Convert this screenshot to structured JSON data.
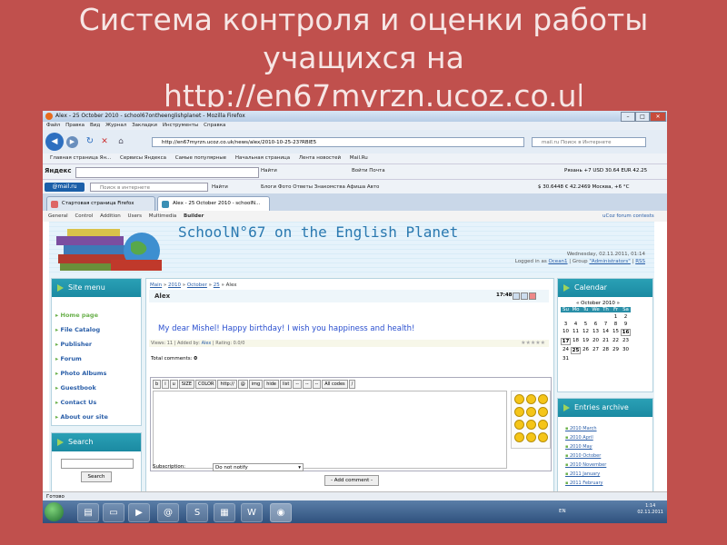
{
  "slide": {
    "title_line1": "Система контроля и оценки работы",
    "title_line2": "учащихся на",
    "url": "http://en67myrzn.ucoz.co.uk"
  },
  "browser": {
    "window_title": "Alex - 25 October 2010 - school67ontheenglishplanet - Mozilla Firefox",
    "menu": [
      "Файл",
      "Правка",
      "Вид",
      "Журнал",
      "Закладки",
      "Инструменты",
      "Справка"
    ],
    "address": "http://en67myrzn.ucoz.co.uk/news/alex/2010-10-25-23?RBlE5",
    "search_placeholder": "mail.ru Поиск в Интернете",
    "bookmarks": [
      "Главная страница Ян...",
      "Сервисы Яндекса",
      "Самые популярные",
      "Начальная страница",
      "Лента новостей",
      "Mail.Ru"
    ],
    "yandex": {
      "logo": "Яндекс",
      "find": "Найти",
      "items": "Войти   Почта   ",
      "rates": "Рязань  +7  USD 30.64  EUR 42.25"
    },
    "mailru": {
      "logo": "@mail.ru",
      "search_placeholder": "Поиск в интернете",
      "find": "Найти",
      "items": "Блоги  Фото  Ответы  Знакомства  Афиша  Авто",
      "rates": "$ 30.6448  € 42.2469    Москва, +6 °C"
    },
    "tabs": [
      {
        "label": "Стартовая страница Firefox"
      },
      {
        "label": "Alex - 25 October 2010 - schoolN..."
      }
    ],
    "ucoz_menu": [
      "General",
      "Control",
      "Addition",
      "Users",
      "Multimedia",
      "Builder"
    ],
    "ucoz_forum": "uCoz forum contests",
    "status": "Готово"
  },
  "site": {
    "name": "SchoolN°67 on the English Planet",
    "date": "Wednesday, 02.11.2011, 01:14",
    "login_prefix": "Logged in as",
    "user": "Ocean1",
    "group_prefix": "Group",
    "group": "\"Administrators\"",
    "rss": "RSS",
    "site_menu_title": "Site menu",
    "menu": [
      "Home page",
      "File Catalog",
      "Publisher",
      "Forum",
      "Photo Albums",
      "Guestbook",
      "Contact Us",
      "About our site"
    ],
    "search_title": "Search",
    "search_button": "Search",
    "breadcrumb": {
      "main": "Main",
      "year": "2010",
      "month": "October",
      "day": "25",
      "current": "Alex"
    },
    "entry": {
      "title": "Alex",
      "time": "17:48",
      "body": "My dear Mishel! Happy birthday! I wish you happiness and health!",
      "views": "Views: 11",
      "added_by": "Added by:",
      "author": "Alex",
      "rating": "Rating: 0.0/0"
    },
    "comments_label": "Total comments:",
    "comments_count": "0",
    "editor_tools": [
      "b",
      "i",
      "u",
      "SIZE",
      "COLOR",
      "http://",
      "@",
      "img",
      "hide",
      "list",
      "--",
      "--",
      "--",
      "All codes",
      "/"
    ],
    "subscription_label": "Subscription:",
    "subscription_value": "Do not notify",
    "add_comment": "- Add comment -",
    "calendar_title": "Calendar",
    "calendar_month": "« October 2010 »",
    "calendar_days": [
      "Su",
      "Mo",
      "Tu",
      "We",
      "Th",
      "Fr",
      "Sa"
    ],
    "calendar_cells": [
      "",
      "",
      "",
      "",
      "",
      "1",
      "2",
      "3",
      "4",
      "5",
      "6",
      "7",
      "8",
      "9",
      "10",
      "11",
      "12",
      "13",
      "14",
      "15",
      "16",
      "17",
      "18",
      "19",
      "20",
      "21",
      "22",
      "23",
      "24",
      "25",
      "26",
      "27",
      "28",
      "29",
      "30",
      "31",
      "",
      "",
      "",
      "",
      "",
      ""
    ],
    "archive_title": "Entries archive",
    "archive": [
      "2010 March",
      "2010 April",
      "2010 May",
      "2010 October",
      "2010 November",
      "2011 January",
      "2011 February"
    ]
  },
  "taskbar": {
    "lang": "EN",
    "time": "1:14",
    "date": "02.11.2011"
  }
}
